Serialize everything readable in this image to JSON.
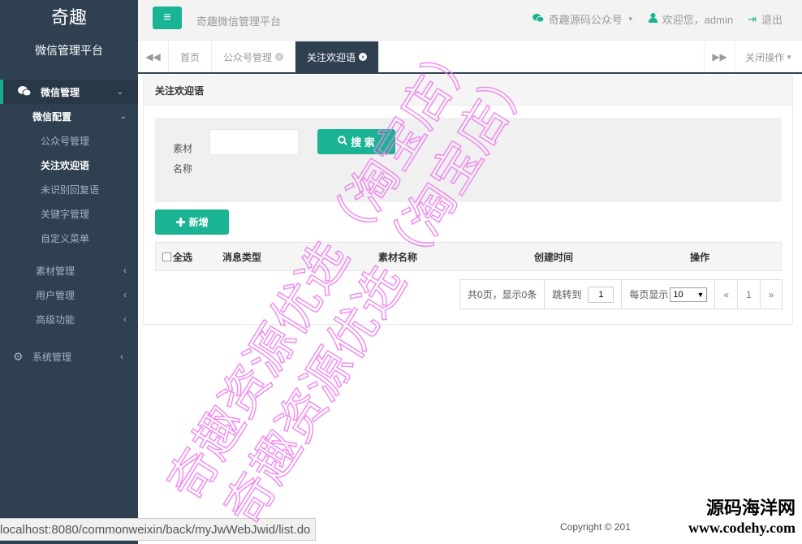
{
  "sidebar": {
    "brand_name": "奇趣",
    "brand_sub": "微信管理平台",
    "group": "微信管理",
    "sub_group": "微信配置",
    "items": [
      "公众号管理",
      "关注欢迎语",
      "未识别回复语",
      "关键字管理",
      "自定义菜单"
    ],
    "active_item": "关注欢迎语",
    "other_groups": [
      "素材管理",
      "用户管理",
      "高级功能"
    ],
    "system": "系统管理"
  },
  "header": {
    "platform_title": "奇趣微信管理平台",
    "account_menu": "奇趣源码公众号",
    "welcome": "欢迎您，admin",
    "logout": "退出"
  },
  "tabs": {
    "items": [
      "首页",
      "公众号管理",
      "关注欢迎语"
    ],
    "active": "关注欢迎语",
    "close_ops": "关闭操作"
  },
  "panel": {
    "title": "关注欢迎语",
    "search_label_1": "素材",
    "search_label_2": "名称",
    "search_value": "",
    "search_button": "搜 索",
    "add_button": "新增"
  },
  "table": {
    "select_all": "全选",
    "columns": [
      "消息类型",
      "素材名称",
      "创建时间",
      "操作"
    ]
  },
  "pager": {
    "summary": "共0页，显示0条",
    "jump_label": "跳转到",
    "jump_value": "1",
    "per_page_label": "每页显示",
    "per_page_value": "10",
    "prev": "«",
    "current": "1",
    "next": "»"
  },
  "status_url": "localhost:8080/commonweixin/back/myJwWebJwid/list.do",
  "copyright": "Copyright © 201",
  "watermarks": {
    "line1": "奇趣资源优选（淘宝店）",
    "line2": "奇趣资源优选（淘宝店）",
    "site_cn": "源码海洋网",
    "site_url": "www.codehy.com"
  },
  "colors": {
    "sidebar_bg": "#2f4050",
    "accent": "#1ab394",
    "watermark": "#ee82ee"
  },
  "icons": [
    "wechat-icon",
    "gear-icon",
    "bars-icon",
    "user-icon",
    "logout-icon",
    "search-icon",
    "plus-icon",
    "backward-icon",
    "forward-icon"
  ]
}
